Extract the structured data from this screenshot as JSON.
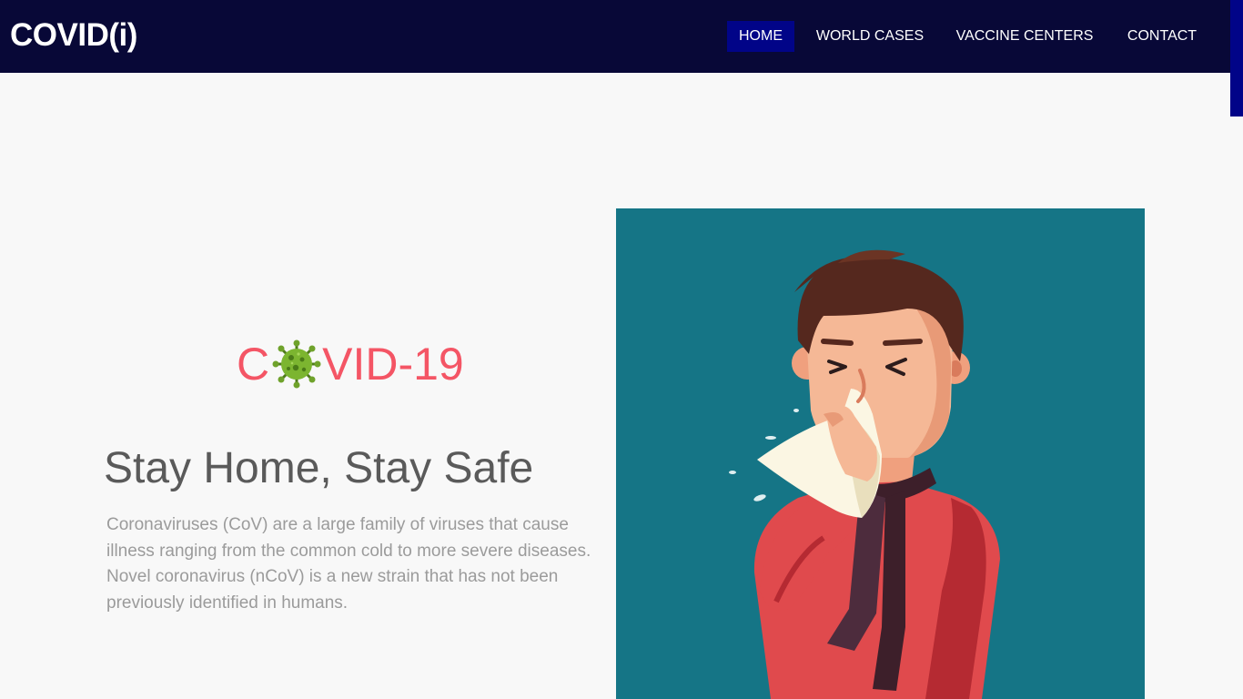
{
  "header": {
    "brand": "COVID(i)",
    "nav": [
      {
        "label": "HOME",
        "active": true
      },
      {
        "label": "WORLD CASES",
        "active": false
      },
      {
        "label": "VACCINE CENTERS",
        "active": false
      },
      {
        "label": "CONTACT",
        "active": false
      }
    ]
  },
  "hero": {
    "title_prefix": "C",
    "title_icon": "virus-icon",
    "title_suffix": "VID-19",
    "headline": "Stay Home, Stay Safe",
    "description": "Coronaviruses (CoV) are a large family of viruses that cause illness ranging from the common cold to more severe diseases. Novel coronavirus (nCoV) is a new strain that has not been previously identified in humans.",
    "illustration_icon": "sneezing-man-illustration"
  },
  "colors": {
    "navbar_bg": "#080837",
    "nav_active_bg": "#010488",
    "title_color": "#f45565",
    "illustration_bg": "#157586",
    "page_bg": "#f8f8f8"
  }
}
